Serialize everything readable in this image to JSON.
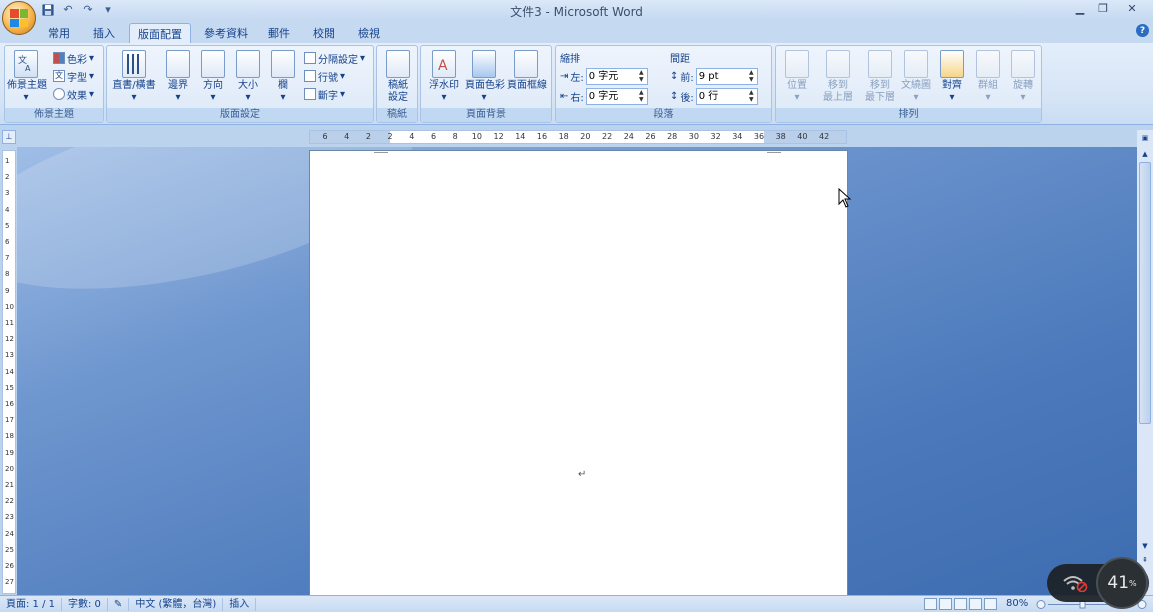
{
  "window": {
    "title": "文件3 - Microsoft Word",
    "minimize_icon": "minimize-icon",
    "restore_icon": "restore-icon",
    "close_icon": "close-icon"
  },
  "tabs": [
    {
      "label": "常用",
      "active": false
    },
    {
      "label": "插入",
      "active": false
    },
    {
      "label": "版面配置",
      "active": true
    },
    {
      "label": "參考資料",
      "active": false
    },
    {
      "label": "郵件",
      "active": false
    },
    {
      "label": "校閱",
      "active": false
    },
    {
      "label": "檢視",
      "active": false
    }
  ],
  "ribbon": {
    "themes": {
      "label": "佈景主題",
      "theme_button": "佈景主題",
      "colors": "色彩",
      "fonts": "字型",
      "effects": "效果"
    },
    "page_setup": {
      "label": "版面設定",
      "orientation_text": "直書/橫書",
      "margins": "邊界",
      "orientation": "方向",
      "size": "大小",
      "columns": "欄",
      "breaks": "分隔設定",
      "line_numbers": "行號",
      "hyphenation": "斷字"
    },
    "manuscript": {
      "label": "稿紙",
      "button_line1": "稿紙",
      "button_line2": "設定"
    },
    "page_background": {
      "label": "頁面背景",
      "watermark": "浮水印",
      "page_color": "頁面色彩",
      "page_borders": "頁面框線"
    },
    "paragraph": {
      "label": "段落",
      "indent_title": "縮排",
      "spacing_title": "間距",
      "indent_left_label": "左:",
      "indent_left_value": "0 字元",
      "indent_right_label": "右:",
      "indent_right_value": "0 字元",
      "spacing_before_label": "前:",
      "spacing_before_value": "9 pt",
      "spacing_after_label": "後:",
      "spacing_after_value": "0 行"
    },
    "arrange": {
      "label": "排列",
      "position": "位置",
      "bring_front_1": "移到",
      "bring_front_2": "最上層",
      "send_back_1": "移到",
      "send_back_2": "最下層",
      "text_wrap": "文繞圖",
      "align": "對齊",
      "group": "群組",
      "rotate": "旋轉"
    }
  },
  "ruler": {
    "ticks": [
      "6",
      "4",
      "2",
      "2",
      "4",
      "6",
      "8",
      "10",
      "12",
      "14",
      "16",
      "18",
      "20",
      "22",
      "24",
      "26",
      "28",
      "30",
      "32",
      "34",
      "36",
      "38",
      "40",
      "42"
    ],
    "vticks": [
      "1",
      "2",
      "3",
      "4",
      "5",
      "6",
      "7",
      "8",
      "9",
      "10",
      "11",
      "12",
      "13",
      "14",
      "15",
      "16",
      "17",
      "18",
      "19",
      "20",
      "21",
      "22",
      "23",
      "24",
      "25",
      "26",
      "27"
    ]
  },
  "document": {
    "paragraph_mark": "↵"
  },
  "statusbar": {
    "page": "頁面: 1 / 1",
    "words": "字數: 0",
    "language": "中文 (繁體，台灣)",
    "mode": "插入",
    "zoom": "80%"
  },
  "overlay": {
    "battery_value": "41",
    "battery_unit": "%"
  },
  "colors": {
    "accent": "#15428b",
    "ribbon_bg": "#dde9f8",
    "workspace": "#4b79bb"
  }
}
